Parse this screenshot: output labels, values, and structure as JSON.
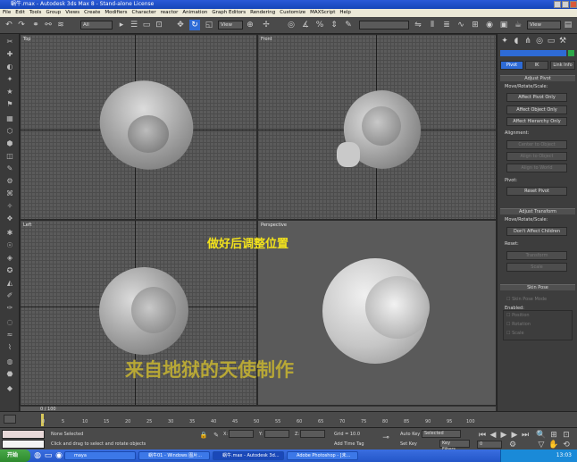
{
  "window": {
    "title": "蜗牛.max - Autodesk 3ds Max 8 - Stand-alone License"
  },
  "menu": [
    "File",
    "Edit",
    "Tools",
    "Group",
    "Views",
    "Create",
    "Modifiers",
    "Character",
    "reactor",
    "Animation",
    "Graph Editors",
    "Rendering",
    "Customize",
    "MAXScript",
    "Help"
  ],
  "toolbar": {
    "selection_filter": "All",
    "ref_coord": "View",
    "named_selection": "",
    "view_right": "View"
  },
  "viewports": {
    "top_left": "Top",
    "top_right": "Front",
    "bottom_left": "Left",
    "bottom_right": "Perspective"
  },
  "command_panel": {
    "tabs": [
      "Pivot",
      "IK",
      "Link Info"
    ],
    "adjust_pivot": {
      "header": "Adjust Pivot",
      "group": "Move/Rotate/Scale:",
      "buttons": [
        "Affect Pivot Only",
        "Affect Object Only",
        "Affect Hierarchy Only"
      ],
      "alignment_label": "Alignment:",
      "alignment_buttons": [
        "Center to Object",
        "Align to Object",
        "Align to World"
      ],
      "pivot_label": "Pivot:",
      "pivot_button": "Reset Pivot"
    },
    "adjust_transform": {
      "header": "Adjust Transform",
      "group": "Move/Rotate/Scale:",
      "button": "Don't Affect Children",
      "reset_label": "Reset:",
      "reset_buttons": [
        "Transform",
        "Scale"
      ]
    },
    "skin_pose": {
      "header": "Skin Pose",
      "check_mode": "Skin Pose Mode",
      "enabled_label": "Enabled:",
      "checks": [
        "Position",
        "Rotation",
        "Scale"
      ]
    }
  },
  "timeline": {
    "slider": "0 / 100",
    "ticks": [
      "0",
      "5",
      "10",
      "15",
      "20",
      "25",
      "30",
      "35",
      "40",
      "45",
      "50",
      "55",
      "60",
      "65",
      "70",
      "75",
      "80",
      "85",
      "90",
      "95",
      "100"
    ]
  },
  "status": {
    "selection": "None Selected",
    "prompt": "Click and drag to select and rotate objects",
    "x_label": "X:",
    "y_label": "Y:",
    "z_label": "Z:",
    "grid": "Grid = 10.0",
    "add_time_tag": "Add Time Tag",
    "auto_key": "Auto Key",
    "set_key": "Set Key",
    "selected": "Selected",
    "key_filters": "Key Filters...",
    "frame": "0"
  },
  "overlays": {
    "instruction": "做好后调整位置",
    "watermark": "来自地狱的天使制作"
  },
  "taskbar": {
    "start": "开始",
    "tasks": [
      "maya",
      "蜗牛01 - Windows 图片...",
      "蜗牛.max - Autodesk 3d...",
      "Adobe Photoshop - [未..."
    ],
    "clock": "13:03"
  }
}
